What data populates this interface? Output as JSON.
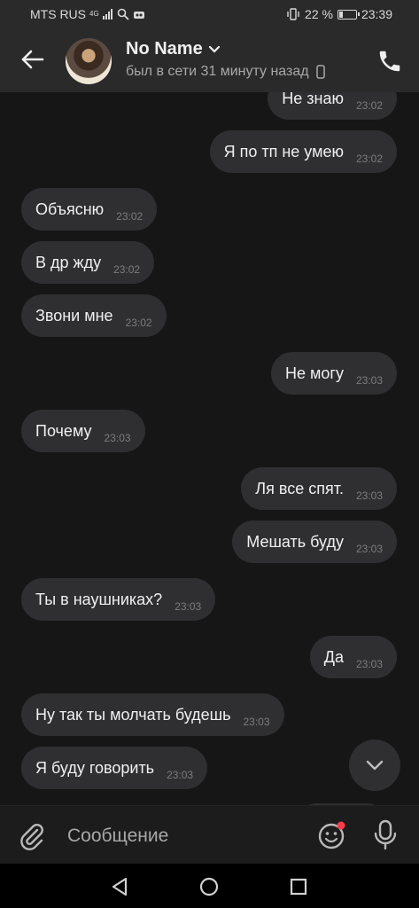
{
  "status_bar": {
    "carrier": "MTS RUS",
    "network": "4G",
    "battery": "22 %",
    "battery_level": 0.22,
    "time": "23:39"
  },
  "header": {
    "contact_name": "No Name",
    "last_seen": "был в сети 31 минуту назад"
  },
  "messages": [
    {
      "text": "Не знаю",
      "time": "23:02",
      "dir": "out"
    },
    {
      "text": "Я по тп не умею",
      "time": "23:02",
      "dir": "out"
    },
    {
      "text": "Объясню",
      "time": "23:02",
      "dir": "in"
    },
    {
      "text": "В др жду",
      "time": "23:02",
      "dir": "in"
    },
    {
      "text": "Звони мне",
      "time": "23:02",
      "dir": "in"
    },
    {
      "text": "Не могу",
      "time": "23:03",
      "dir": "out"
    },
    {
      "text": "Почему",
      "time": "23:03",
      "dir": "in"
    },
    {
      "text": "Ля все спят.",
      "time": "23:03",
      "dir": "out"
    },
    {
      "text": "Мешать буду",
      "time": "23:03",
      "dir": "out"
    },
    {
      "text": "Ты в наушниках?",
      "time": "23:03",
      "dir": "in"
    },
    {
      "text": "Да",
      "time": "23:03",
      "dir": "out"
    },
    {
      "text": "Ну так ты молчать будешь",
      "time": "23:03",
      "dir": "in"
    },
    {
      "text": "Я буду говорить",
      "time": "23:03",
      "dir": "in"
    }
  ],
  "composer": {
    "placeholder": "Сообщение"
  },
  "icons": {
    "back": "arrow-left-icon",
    "phone": "phone-icon",
    "attach": "paperclip-icon",
    "emoji": "smiley-icon",
    "mic": "microphone-icon",
    "scroll_down": "chevron-down-icon"
  },
  "colors": {
    "background": "#161617",
    "bubble": "#2f2f31",
    "header": "#2a2a2b",
    "emoji_badge": "#ff3b47"
  }
}
